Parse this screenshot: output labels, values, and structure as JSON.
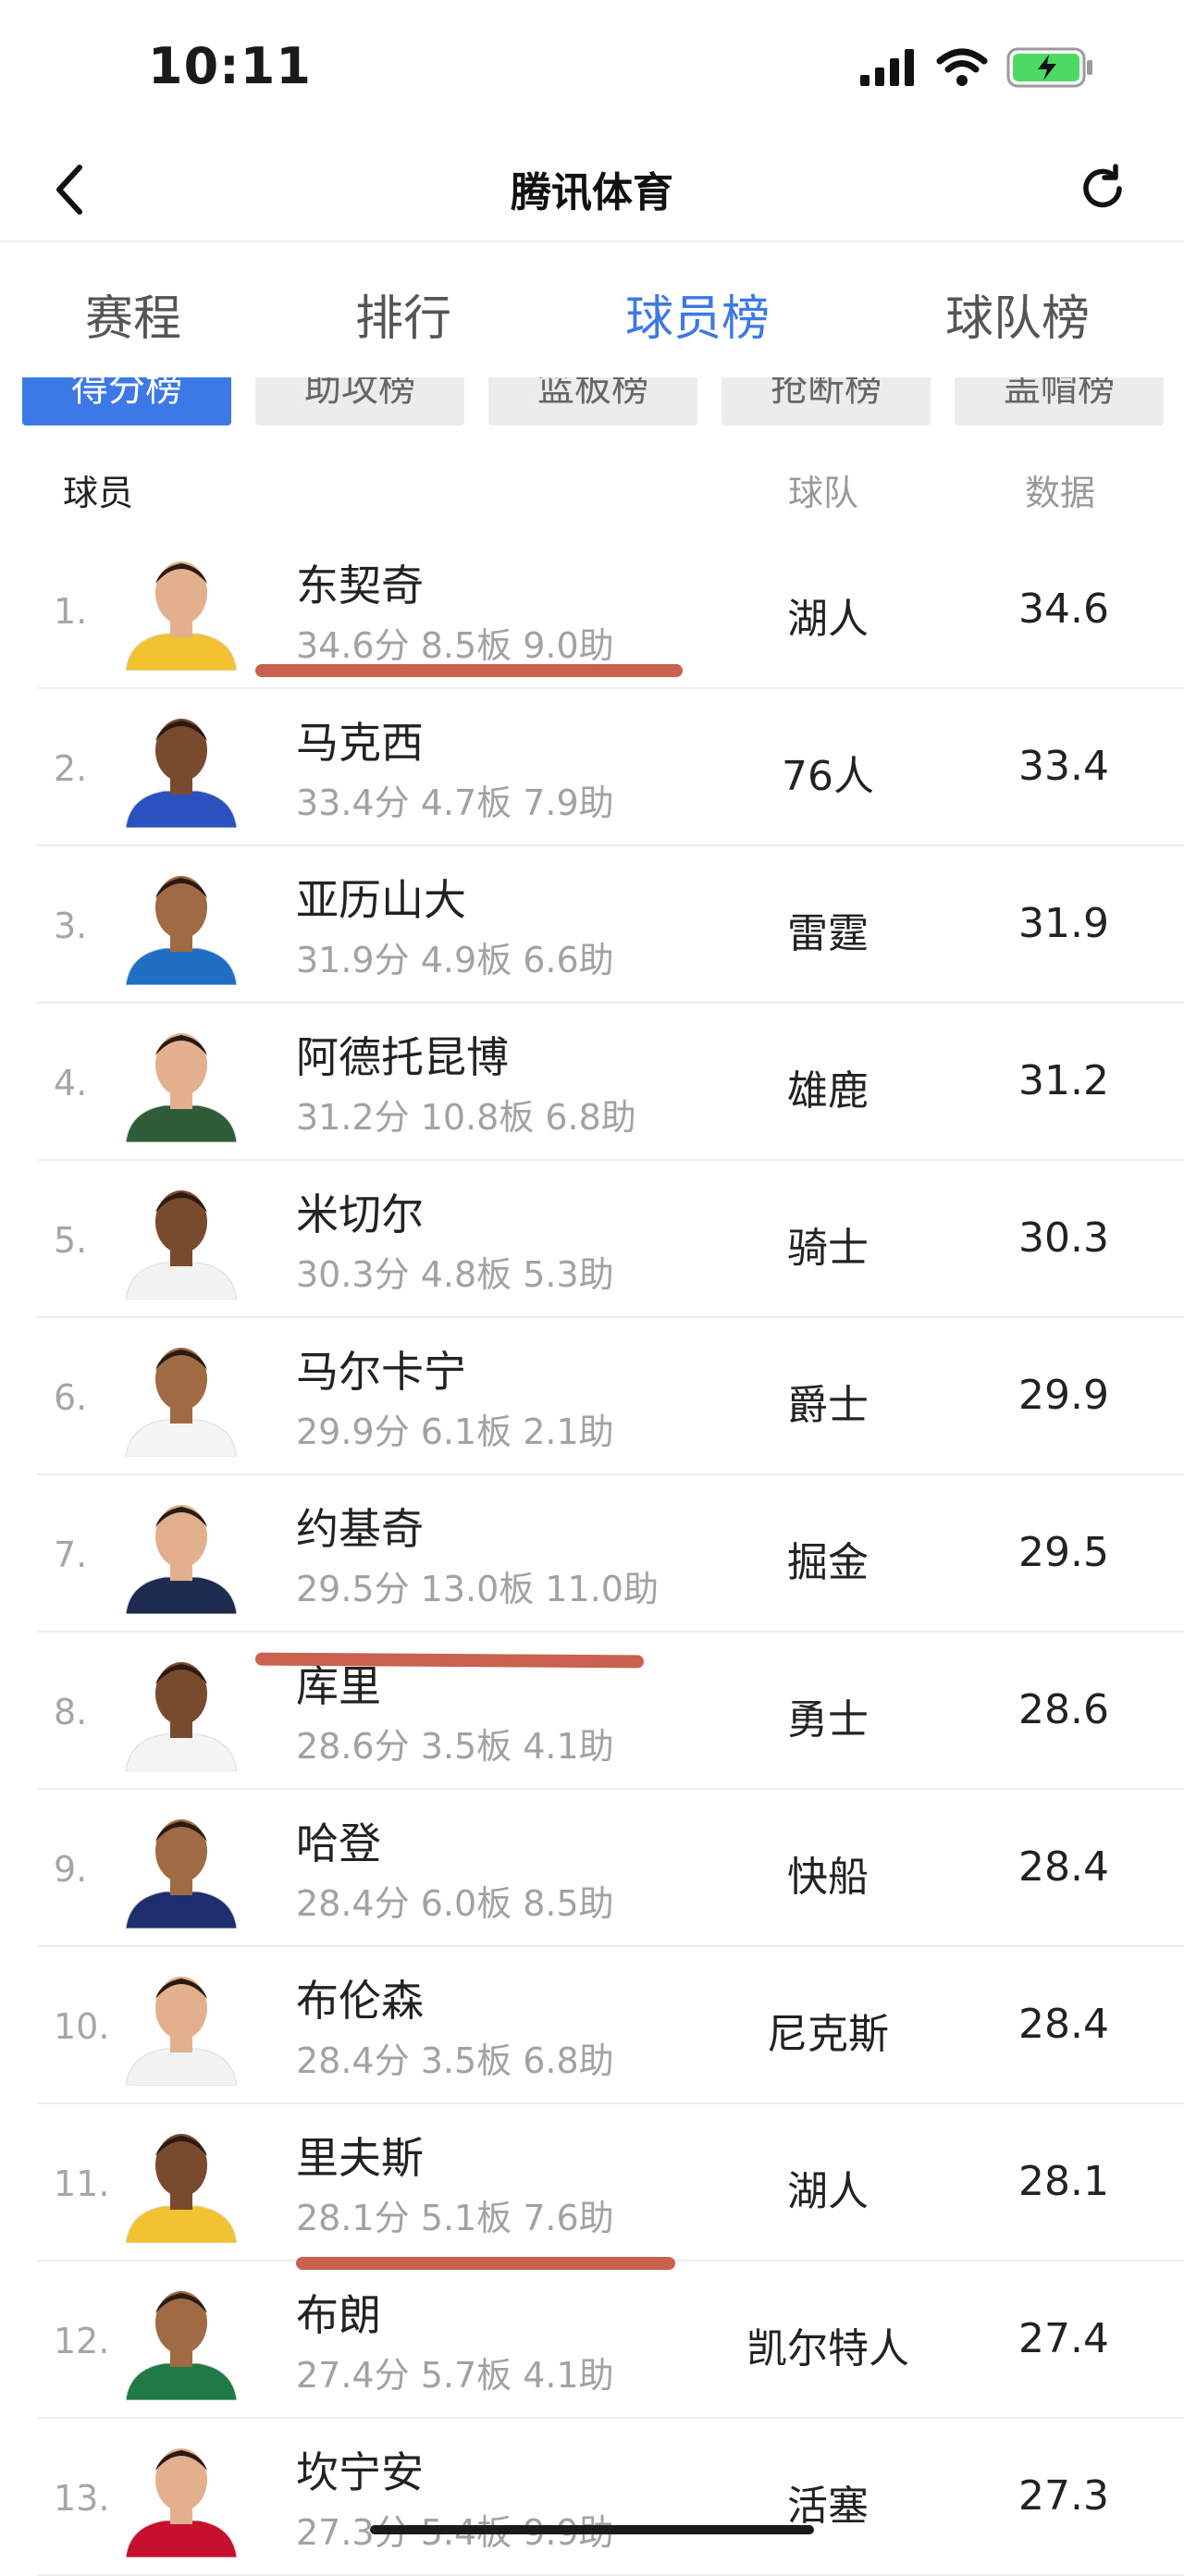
{
  "status_bar": {
    "time": "10:11"
  },
  "nav": {
    "title": "腾讯体育"
  },
  "main_tabs": [
    "赛程",
    "排行",
    "球员榜",
    "球队榜"
  ],
  "active_main_tab": "球员榜",
  "sub_tabs": [
    "得分榜",
    "助攻榜",
    "篮板榜",
    "抢断榜",
    "盖帽榜"
  ],
  "active_sub_tab": "得分榜",
  "table_header": {
    "player": "球员",
    "team": "球队",
    "data": "数据"
  },
  "rows": [
    {
      "rank": "1.",
      "name": "东契奇",
      "stats": "34.6分 8.5板 9.0助",
      "team": "湖人",
      "value": "34.6",
      "jersey": "#f2c230"
    },
    {
      "rank": "2.",
      "name": "马克西",
      "stats": "33.4分 4.7板 7.9助",
      "team": "76人",
      "value": "33.4",
      "jersey": "#2a52be"
    },
    {
      "rank": "3.",
      "name": "亚历山大",
      "stats": "31.9分 4.9板 6.6助",
      "team": "雷霆",
      "value": "31.9",
      "jersey": "#1f6fc5"
    },
    {
      "rank": "4.",
      "name": "阿德托昆博",
      "stats": "31.2分 10.8板 6.8助",
      "team": "雄鹿",
      "value": "31.2",
      "jersey": "#2f5d3a"
    },
    {
      "rank": "5.",
      "name": "米切尔",
      "stats": "30.3分 4.8板 5.3助",
      "team": "骑士",
      "value": "30.3",
      "jersey": "#f2f2f2"
    },
    {
      "rank": "6.",
      "name": "马尔卡宁",
      "stats": "29.9分 6.1板 2.1助",
      "team": "爵士",
      "value": "29.9",
      "jersey": "#f5f5f5"
    },
    {
      "rank": "7.",
      "name": "约基奇",
      "stats": "29.5分 13.0板 11.0助",
      "team": "掘金",
      "value": "29.5",
      "jersey": "#1d2b4f"
    },
    {
      "rank": "8.",
      "name": "库里",
      "stats": "28.6分 3.5板 4.1助",
      "team": "勇士",
      "value": "28.6",
      "jersey": "#f4f4f4"
    },
    {
      "rank": "9.",
      "name": "哈登",
      "stats": "28.4分 6.0板 8.5助",
      "team": "快船",
      "value": "28.4",
      "jersey": "#1e2f6e"
    },
    {
      "rank": "10.",
      "name": "布伦森",
      "stats": "28.4分 3.5板 6.8助",
      "team": "尼克斯",
      "value": "28.4",
      "jersey": "#f2f2f2"
    },
    {
      "rank": "11.",
      "name": "里夫斯",
      "stats": "28.1分 5.1板 7.6助",
      "team": "湖人",
      "value": "28.1",
      "jersey": "#f2c230"
    },
    {
      "rank": "12.",
      "name": "布朗",
      "stats": "27.4分 5.7板 4.1助",
      "team": "凯尔特人",
      "value": "27.4",
      "jersey": "#1f7a45"
    },
    {
      "rank": "13.",
      "name": "坎宁安",
      "stats": "27.3分 5.4板 9.9助",
      "team": "活塞",
      "value": "27.3",
      "jersey": "#c8102e"
    }
  ],
  "colors": {
    "accent": "#3c78e6",
    "underline_mark": "#c4503c"
  },
  "icons": [
    "back-chevron-icon",
    "refresh-icon",
    "signal-icon",
    "wifi-icon",
    "battery-icon"
  ]
}
